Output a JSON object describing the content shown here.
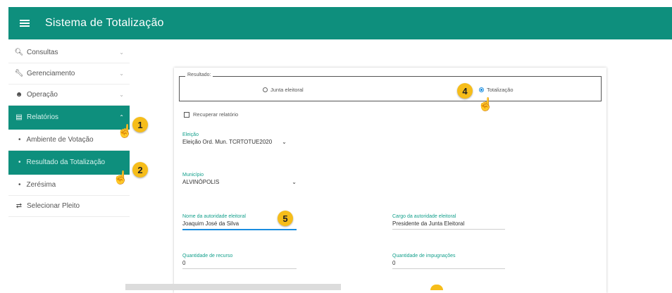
{
  "app": {
    "title": "Sistema de Totalização"
  },
  "colors": {
    "primary": "#0e8f7d",
    "accent_badge": "#f6bd1a",
    "radio_checked": "#1a8de0"
  },
  "sidebar": {
    "items": [
      {
        "label": "Consultas",
        "icon": "search-icon"
      },
      {
        "label": "Gerenciamento",
        "icon": "wrench-icon"
      },
      {
        "label": "Operação",
        "icon": "people-icon"
      },
      {
        "label": "Relatórios",
        "icon": "report-icon"
      },
      {
        "label": "Ambiente de Votação"
      },
      {
        "label": "Resultado da Totalização"
      },
      {
        "label": "Zerésima"
      },
      {
        "label": "Selecionar Pleito",
        "icon": "switch-icon"
      }
    ]
  },
  "badges": [
    "1",
    "2",
    "4",
    "5"
  ],
  "form": {
    "resultado_legend": "Resultado:",
    "radio_junta": "Junta eleitoral",
    "radio_totalizacao": "Totalização",
    "recuperar_label": "Recuperar relatório",
    "eleicao": {
      "label": "Eleição",
      "value": "Eleição Ord. Mun. TCRTOTUE2020"
    },
    "municipio": {
      "label": "Município",
      "value": "ALVINÓPOLIS"
    },
    "autoridade": {
      "label": "Nome da autoridade eleitoral",
      "value": "Joaquim José da Silva"
    },
    "cargo": {
      "label": "Cargo da autoridade eleitoral",
      "value": "Presidente da Junta Eleitoral"
    },
    "recurso": {
      "label": "Quantidade de recurso",
      "value": "0"
    },
    "impugnacoes": {
      "label": "Quantidade de impugnações",
      "value": "0"
    }
  }
}
